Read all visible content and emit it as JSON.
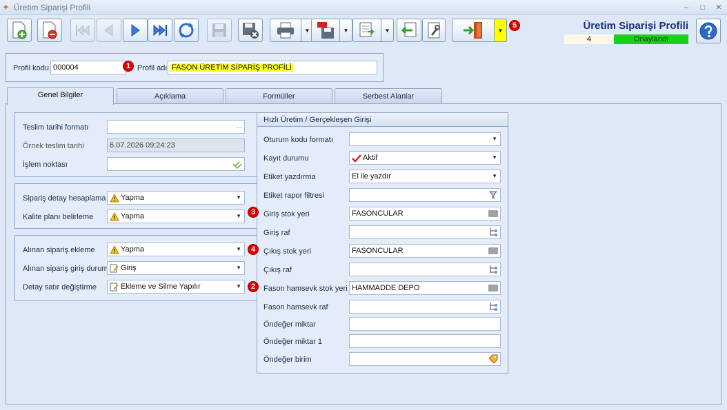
{
  "window": {
    "title": "Üretim Siparişi Profili",
    "minimize": "–",
    "maximize": "□",
    "close": "✕"
  },
  "toolbar": {
    "dropdown_glyph": "▼"
  },
  "header": {
    "title": "Üretim Siparişi Profili",
    "number": "4",
    "status": "Onaylandı",
    "status_color": "#1bd01b"
  },
  "badges": {
    "b1": "1",
    "b2": "2",
    "b3": "3",
    "b4": "4",
    "b5": "5"
  },
  "profile": {
    "code_label": "Profil kodu",
    "code_value": "000004",
    "name_label": "Profil adı",
    "name_value": "FASON ÜRETİM SİPARİŞ PROFİLİ"
  },
  "tabs": [
    "Genel Bilgiler",
    "Açıklama",
    "Formüller",
    "Serbest Alanlar"
  ],
  "left": {
    "g1": {
      "delivery_format_label": "Teslim tarihi formatı",
      "delivery_format_btn": "...",
      "sample_date_label": "Örnek teslim tarihi",
      "sample_date_value": "6.07.2026 09:24:23",
      "process_point_label": "İşlem noktası"
    },
    "g2": {
      "detail_calc_label": "Sipariş detay hesaplama",
      "detail_calc_value": "Yapma",
      "quality_plan_label": "Kalite planı belirleme",
      "quality_plan_value": "Yapma"
    },
    "g3": {
      "received_add_label": "Alınan sipariş ekleme",
      "received_add_value": "Yapma",
      "received_entry_label": "Alınan sipariş giriş durum",
      "received_entry_value": "Giriş",
      "detail_change_label": "Detay satır değiştirme",
      "detail_change_value": "Ekleme ve Silme Yapılır"
    }
  },
  "right": {
    "title": "Hızlı Üretim / Gerçekleşen Girişi",
    "session_format_label": "Oturum kodu formatı",
    "record_status_label": "Kayıt durumu",
    "record_status_value": "Aktif",
    "label_print_label": "Etiket yazdırma",
    "label_print_value": "El ile yazdır",
    "label_report_label": "Etiket rapor filtresi",
    "in_stock_label": "Giriş stok yeri",
    "in_stock_value": "FASONCULAR",
    "in_shelf_label": "Giriş raf",
    "out_stock_label": "Çıkış stok yeri",
    "out_stock_value": "FASONCULAR",
    "out_shelf_label": "Çıkış raf",
    "fason_stock_label": "Fason hamsevk stok yeri",
    "fason_stock_value": "HAMMADDE DEPO",
    "fason_shelf_label": "Fason hamsevk raf",
    "def_qty_label": "Öndeğer miktar",
    "def_qty1_label": "Öndeğer miktar 1",
    "def_unit_label": "Öndeğer birim"
  }
}
